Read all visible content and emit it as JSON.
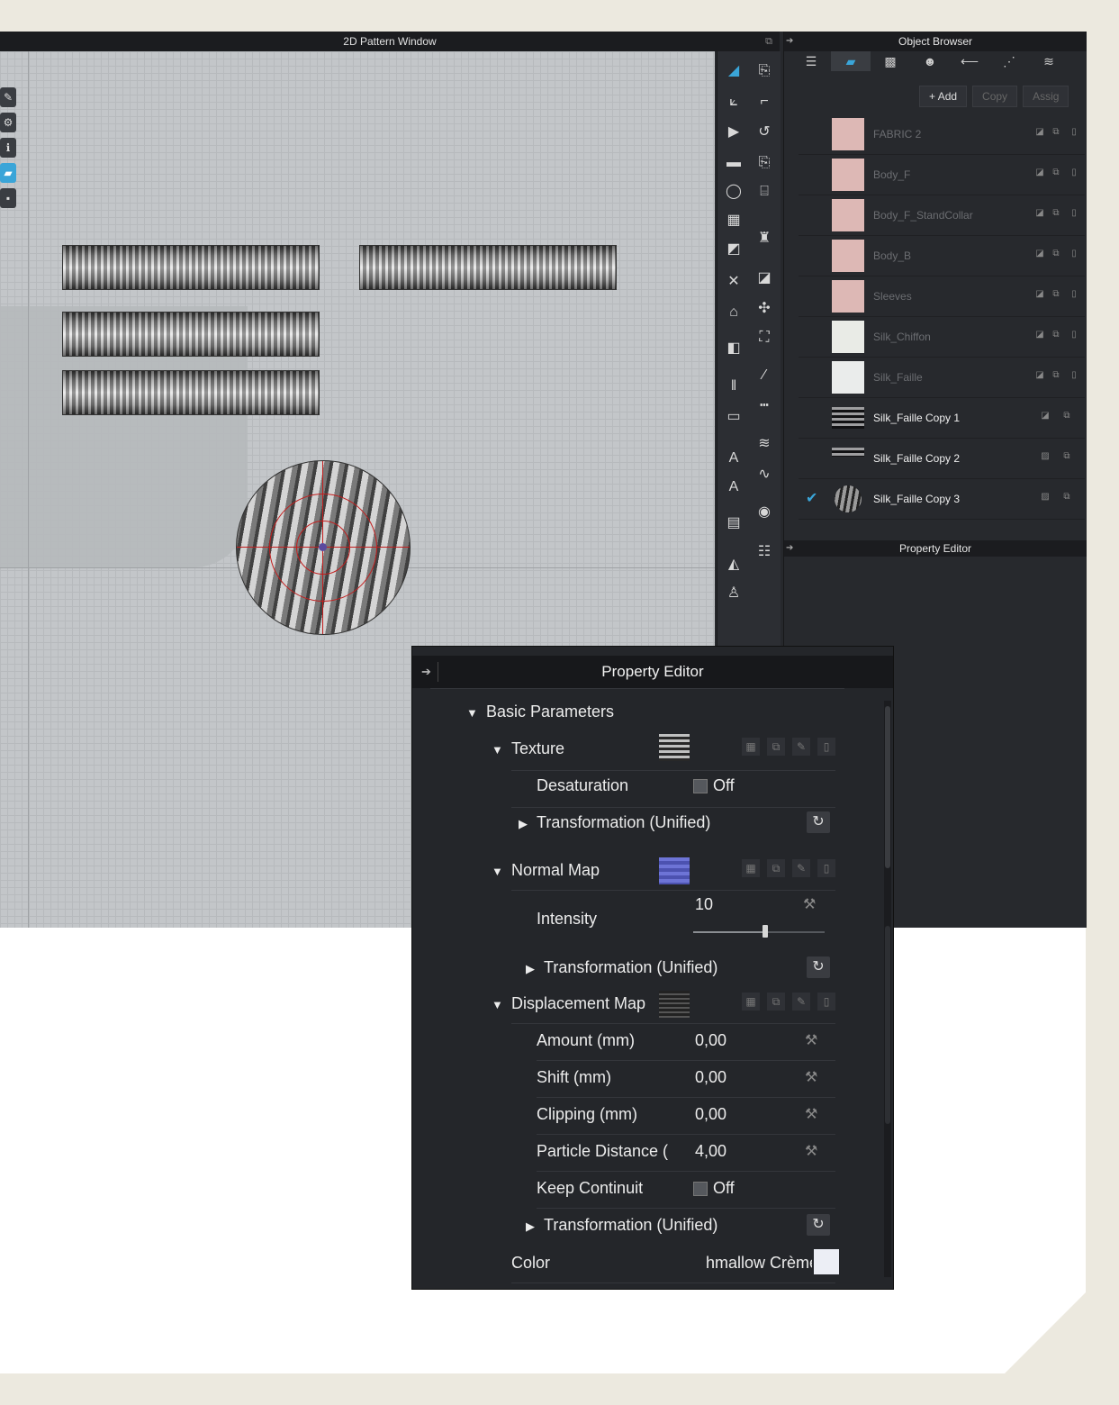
{
  "pattern_window": {
    "title": "2D Pattern Window"
  },
  "object_browser": {
    "title": "Object Browser",
    "buttons": {
      "add": "Add",
      "copy": "Copy",
      "assign": "Assig"
    },
    "fabrics": [
      {
        "name": "FABRIC 2",
        "swatch": "#ddb8b5"
      },
      {
        "name": "Body_F",
        "swatch": "#ddb8b5"
      },
      {
        "name": "Body_F_StandCollar",
        "swatch": "#ddb8b5"
      },
      {
        "name": "Body_B",
        "swatch": "#ddb8b5"
      },
      {
        "name": "Sleeves",
        "swatch": "#ddb8b5"
      },
      {
        "name": "Silk_Chiffon",
        "swatch": "#e9ebe6"
      },
      {
        "name": "Silk_Faille",
        "swatch": "#eaeceb"
      },
      {
        "name": "Silk_Faille Copy 1"
      },
      {
        "name": "Silk_Faille Copy 2"
      },
      {
        "name": "Silk_Faille Copy 3",
        "selected": true
      }
    ]
  },
  "property_editor_small": {
    "title": "Property Editor"
  },
  "property_editor": {
    "title": "Property Editor",
    "basic_parameters": "Basic Parameters",
    "texture": {
      "label": "Texture",
      "desaturation_label": "Desaturation",
      "desaturation_value": "Off",
      "transformation": "Transformation (Unified)"
    },
    "normal_map": {
      "label": "Normal Map",
      "intensity_label": "Intensity",
      "intensity_value": "10",
      "intensity_fraction": 0.55,
      "transformation": "Transformation (Unified)"
    },
    "displacement_map": {
      "label": "Displacement Map",
      "amount_label": "Amount (mm)",
      "amount_value": "0,00",
      "shift_label": "Shift (mm)",
      "shift_value": "0,00",
      "clipping_label": "Clipping (mm)",
      "clipping_value": "0,00",
      "particle_label": "Particle Distance (",
      "particle_value": "4,00",
      "keep_label": "Keep Continuit",
      "keep_value": "Off",
      "transformation": "Transformation (Unified)"
    },
    "color": {
      "label": "Color",
      "value": "hmallow Crème",
      "swatch": "#eceef5"
    }
  },
  "colors": {
    "accent": "#3aa5d8",
    "canvas": "#c3c6c9",
    "panel": "#26282c",
    "outline": "#c21e1e"
  }
}
